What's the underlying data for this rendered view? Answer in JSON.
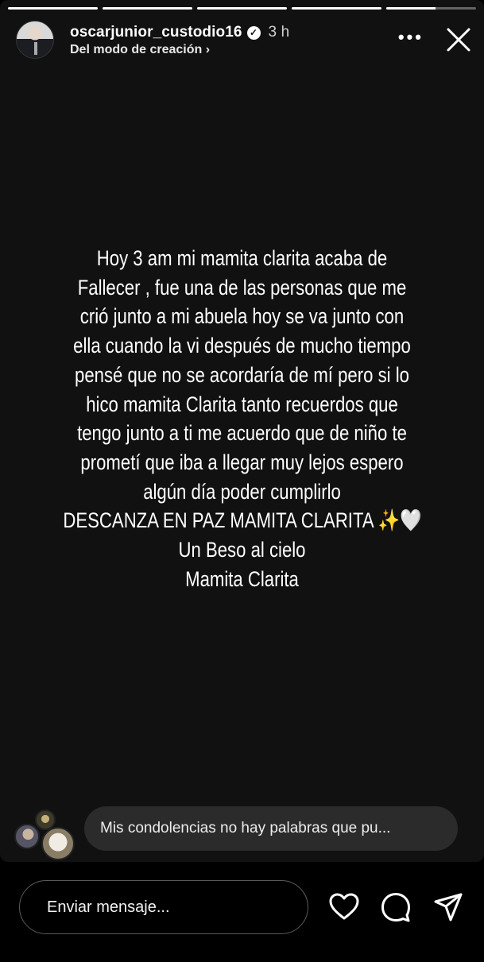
{
  "header": {
    "username": "oscarjunior_custodio16",
    "verified_icon": "verified-badge-icon",
    "time_ago": "3 h",
    "subtitle": "Del modo de creación ›",
    "more_label": "•••"
  },
  "story": {
    "progress_segments": [
      {
        "fill_percent": 100
      },
      {
        "fill_percent": 100
      },
      {
        "fill_percent": 100
      },
      {
        "fill_percent": 100
      },
      {
        "fill_percent": 55
      }
    ],
    "caption_lines": [
      "Hoy 3 am mi mamita clarita acaba de",
      "Fallecer ,  fue una de las personas que me",
      "crió junto a mi abuela hoy se va junto con",
      "ella cuando la vi después de mucho tiempo",
      "pensé que no se acordaría de mí pero si lo",
      "hico mamita Clarita tanto recuerdos que",
      "tengo junto a ti me acuerdo que de niño te",
      "prometí que iba a llegar muy lejos espero",
      "algún día poder cumplirlo",
      "DESCANZA EN PAZ MAMITA CLARITA ✨🤍",
      "Un Beso al cielo",
      "Mamita Clarita"
    ]
  },
  "reply_preview": {
    "text": "Mis condolencias no hay palabras que pu..."
  },
  "composer": {
    "placeholder": "Enviar mensaje..."
  },
  "colors": {
    "story_bg": "#111111",
    "bubble_bg": "#2b2b2b"
  }
}
